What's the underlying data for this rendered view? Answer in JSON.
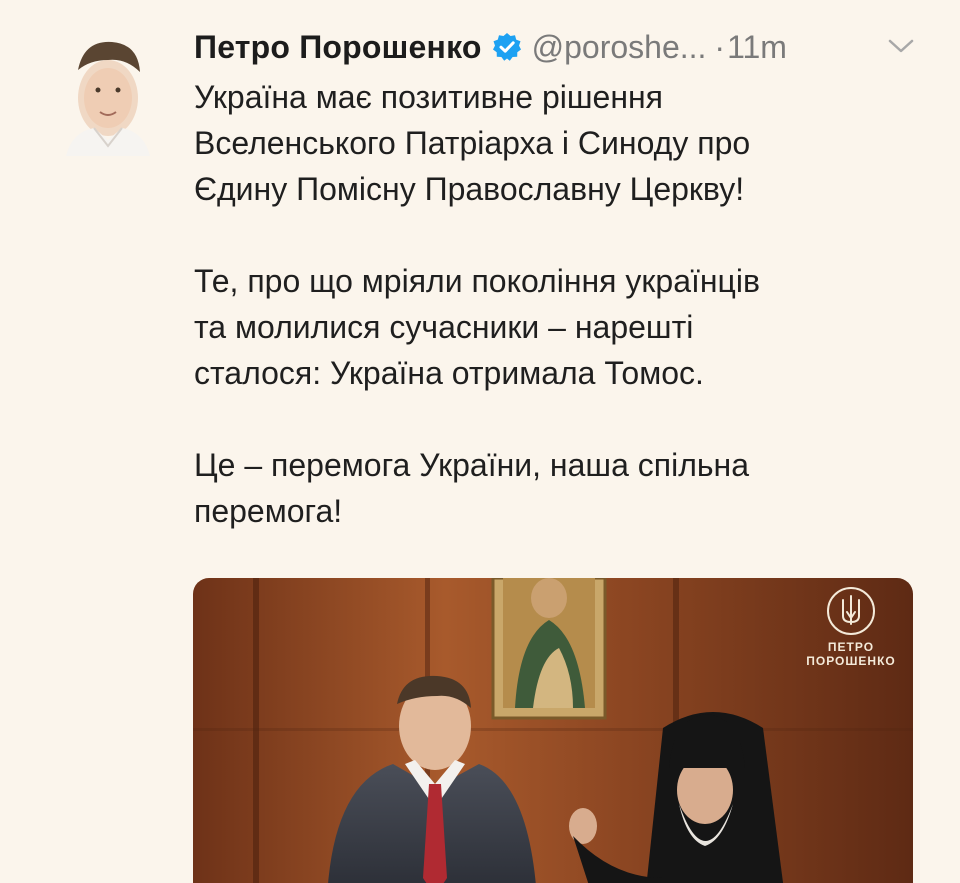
{
  "tweet": {
    "author_name": "Петро Порошенко",
    "handle": "@poroshe...",
    "separator": "·",
    "time": "11m",
    "paragraphs": [
      "Україна має позитивне рішення\nВселенського Патріарха і Синоду про\nЄдину Помісну Православну Церкву!",
      "Те, про що мріяли покоління українців\nта молилися сучасники – нарешті\nсталося: Україна отримала Томос.",
      "Це – перемога України, наша спільна\nперемога!"
    ]
  },
  "media": {
    "brand_line1": "ПЕТРО",
    "brand_line2": "ПОРОШЕНКО"
  },
  "icons": {
    "verified": "verified-badge-icon",
    "caret": "chevron-down-icon",
    "brand": "trident-icon"
  },
  "colors": {
    "background": "#fbf5ec",
    "verified_blue": "#1da1f2",
    "muted": "#7a7a7a",
    "text": "#1f1f1f"
  }
}
